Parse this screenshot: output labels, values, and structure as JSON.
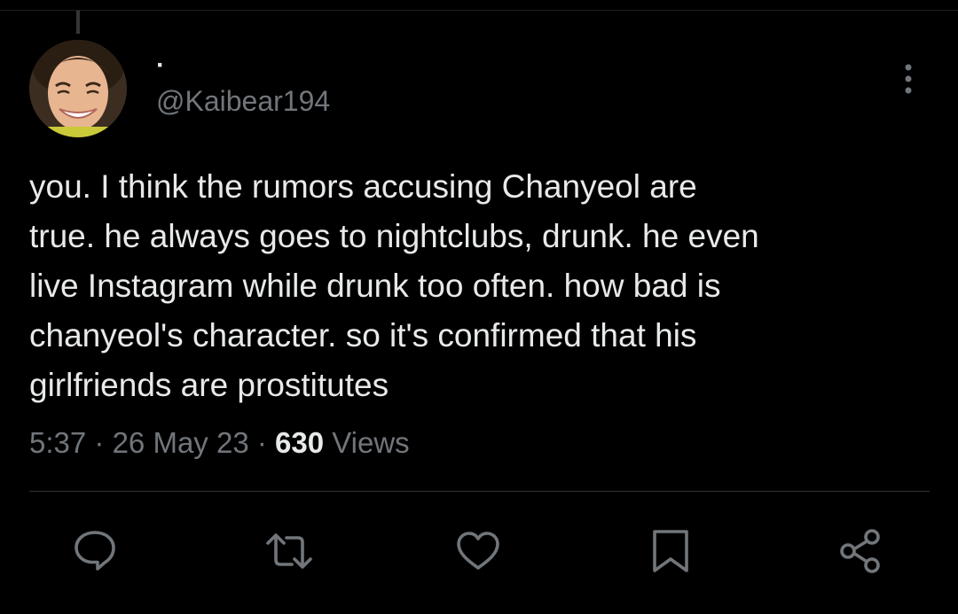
{
  "tweet": {
    "display_name": "·",
    "handle": "@Kaibear194",
    "text": "you. I think the rumors accusing Chanyeol are\ntrue. he always goes to nightclubs, drunk. he even\nlive Instagram while drunk too often. how bad is\nchanyeol's character. so it's confirmed that his\ngirlfriends are prostitutes",
    "time": "5:37",
    "separator": "·",
    "date": "26 May 23",
    "views_count": "630",
    "views_label": "Views"
  },
  "icons": {
    "more": "more-vertical-icon",
    "reply": "reply-icon",
    "retweet": "retweet-icon",
    "like": "heart-icon",
    "bookmark": "bookmark-icon",
    "share": "share-icon"
  },
  "colors": {
    "background": "#000000",
    "primary_text": "#e7e9ea",
    "secondary_text": "#71767b",
    "divider": "#2f3336"
  }
}
